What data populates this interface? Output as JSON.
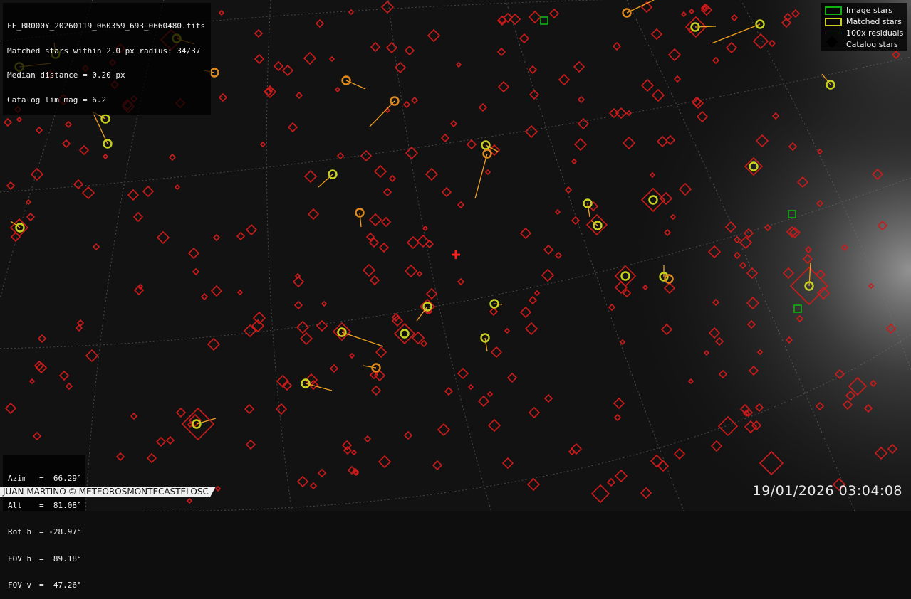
{
  "header": {
    "filename": "FF_BR000Y_20260119_060359_693_0660480.fits",
    "matched_line": "Matched stars within 2.0 px radius: 34/37",
    "median_line": "Median distance = 0.20 px",
    "catalog_line": "Catalog lim mag = 6.2"
  },
  "legend": {
    "image_stars": "Image stars",
    "matched_stars": "Matched stars",
    "residuals": "100x residuals",
    "catalog_stars": "Catalog stars"
  },
  "pointing": {
    "azim": {
      "label": "Azim",
      "value": "=  66.29°"
    },
    "alt": {
      "label": "Alt",
      "value": "=  81.08°"
    },
    "roth": {
      "label": "Rot h",
      "value": "= -28.97°"
    },
    "fovh": {
      "label": "FOV h",
      "value": "=  89.18°"
    },
    "fovv": {
      "label": "FOV v",
      "value": "=  47.26°"
    }
  },
  "credit": {
    "author": "JUAN MARTINO",
    "symbol": "©",
    "station": "METEOROSMONTECASTELOSC"
  },
  "timestamp": "19/01/2026 03:04:08",
  "colors": {
    "catalog": "#cc1b1b",
    "matched": "#c8d21e",
    "matched_alt": "#e08a1e",
    "residual": "#f0a020",
    "image": "#12b212",
    "grid": "#777777",
    "center_marker": "#ff2020"
  },
  "icons": {
    "catalog": "diamond-icon",
    "matched": "circle-icon",
    "image": "square-icon",
    "center": "cross-icon"
  }
}
